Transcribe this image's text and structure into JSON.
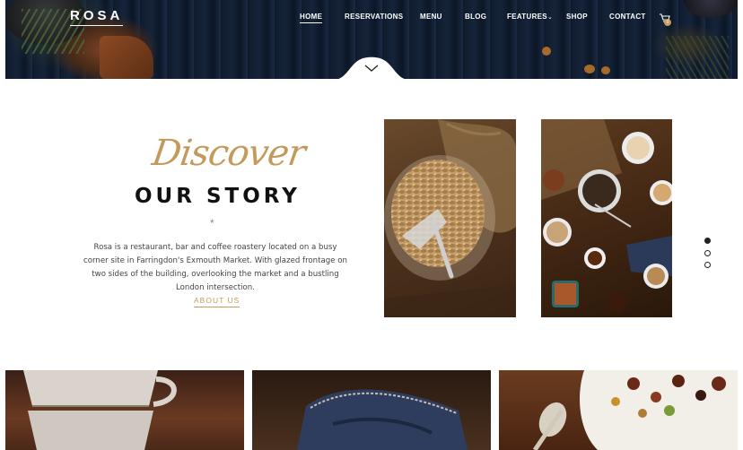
{
  "brand": {
    "logo": "ROSA"
  },
  "nav": {
    "items": [
      {
        "label": "HOME",
        "active": true
      },
      {
        "label": "RESERVATIONS",
        "active": false
      },
      {
        "label": "MENU",
        "active": false
      },
      {
        "label": "BLOG",
        "active": false
      },
      {
        "label": "FEATURES",
        "active": false
      },
      {
        "label": "SHOP",
        "active": false
      },
      {
        "label": "CONTACT",
        "active": false
      }
    ],
    "cart_count": "0"
  },
  "story": {
    "script_title": "Discover",
    "title": "OUR STORY",
    "divider": "*",
    "text": "Rosa is a restaurant, bar and coffee roastery located on a busy corner site in Farringdon's Exmouth Market. With glazed frontage on two sides of the building, overlooking the market and a bustling London intersection.",
    "link_label": "ABOUT US"
  },
  "slider": {
    "dots": 3,
    "active_index": 0
  },
  "colors": {
    "accent": "#c49a5c",
    "header_bg": "#12203a",
    "text": "#444444"
  },
  "icons": [
    "chevron-down-icon",
    "cart-icon"
  ]
}
